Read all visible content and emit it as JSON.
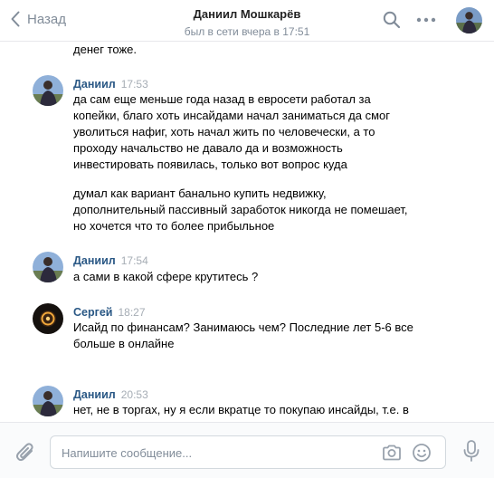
{
  "header": {
    "back_label": "Назад",
    "title": "Даниил Мошкарёв",
    "status": "был в сети вчера в 17:51"
  },
  "feed": {
    "top_fragment": "денег тоже.",
    "messages": [
      {
        "author": "Даниил",
        "time": "17:53",
        "lines": [
          "да сам еще меньше года назад в евросети работал за",
          "копейки, благо хоть инсайдами начал заниматься да смог",
          "уволиться нафиг, хоть начал жить по человечески, а то",
          "проходу начальство не давало да и возможность",
          "инвестировать появилась, только вот вопрос куда"
        ],
        "lines2": [
          "думал как вариант банально купить недвижку,",
          "дополнительный пассивный заработок никогда не помешает,",
          "но хочется что то более прибыльное"
        ]
      },
      {
        "author": "Даниил",
        "time": "17:54",
        "lines": [
          "а сами в какой сфере крутитесь ?"
        ]
      },
      {
        "author": "Сергей",
        "time": "18:27",
        "lines": [
          "Исайд по финансам? Занимаюсь чем? Последние лет 5-6 все",
          "больше в онлайне"
        ]
      },
      {
        "author": "Даниил",
        "time": "20:53",
        "lines": [
          "нет, не в торгах, ну я если вкратце то покупаю инсайды, т.е. в"
        ]
      }
    ]
  },
  "composer": {
    "placeholder": "Напишите сообщение..."
  },
  "icons": {
    "back": "chevron-left-icon",
    "search": "search-icon",
    "more": "more-horizontal-icon",
    "attach": "paperclip-icon",
    "camera": "camera-icon",
    "emoji": "smile-icon",
    "voice": "microphone-icon"
  },
  "colors": {
    "name": "#2a5885",
    "muted": "#818c99",
    "time": "#a6adb5"
  }
}
